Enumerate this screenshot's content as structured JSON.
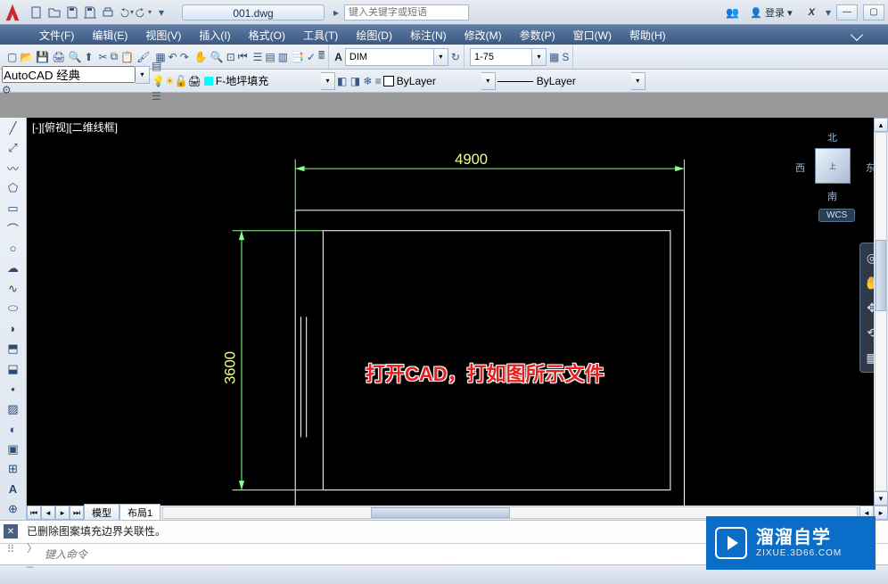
{
  "titlebar": {
    "filename": "001.dwg",
    "search_placeholder": "键入关键字或短语",
    "login_label": "登录",
    "exchange_label": "X"
  },
  "menus": [
    {
      "label": "文件(F)"
    },
    {
      "label": "编辑(E)"
    },
    {
      "label": "视图(V)"
    },
    {
      "label": "插入(I)"
    },
    {
      "label": "格式(O)"
    },
    {
      "label": "工具(T)"
    },
    {
      "label": "绘图(D)"
    },
    {
      "label": "标注(N)"
    },
    {
      "label": "修改(M)"
    },
    {
      "label": "参数(P)"
    },
    {
      "label": "窗口(W)"
    },
    {
      "label": "帮助(H)"
    }
  ],
  "workspace": {
    "name": "AutoCAD 经典"
  },
  "layer": {
    "current": "F-地坪填充"
  },
  "props": {
    "style": "DIM",
    "scale": "1-75",
    "color": "ByLayer",
    "linetype": "ByLayer"
  },
  "viewport": {
    "label": "[-][俯视][二维线框]"
  },
  "dims": {
    "width": "4900",
    "height": "3600"
  },
  "viewcube": {
    "n": "北",
    "s": "南",
    "e": "东",
    "w": "西",
    "top": "上",
    "wcs": "WCS"
  },
  "tabs": {
    "model": "模型",
    "layout1": "布局1"
  },
  "command": {
    "history": "已删除图案填充边界关联性。",
    "prompt_placeholder": "键入命令"
  },
  "annotation": "打开CAD，打如图所示文件",
  "watermark": {
    "title": "溜溜自学",
    "url": "ZIXUE.3D66.COM"
  }
}
